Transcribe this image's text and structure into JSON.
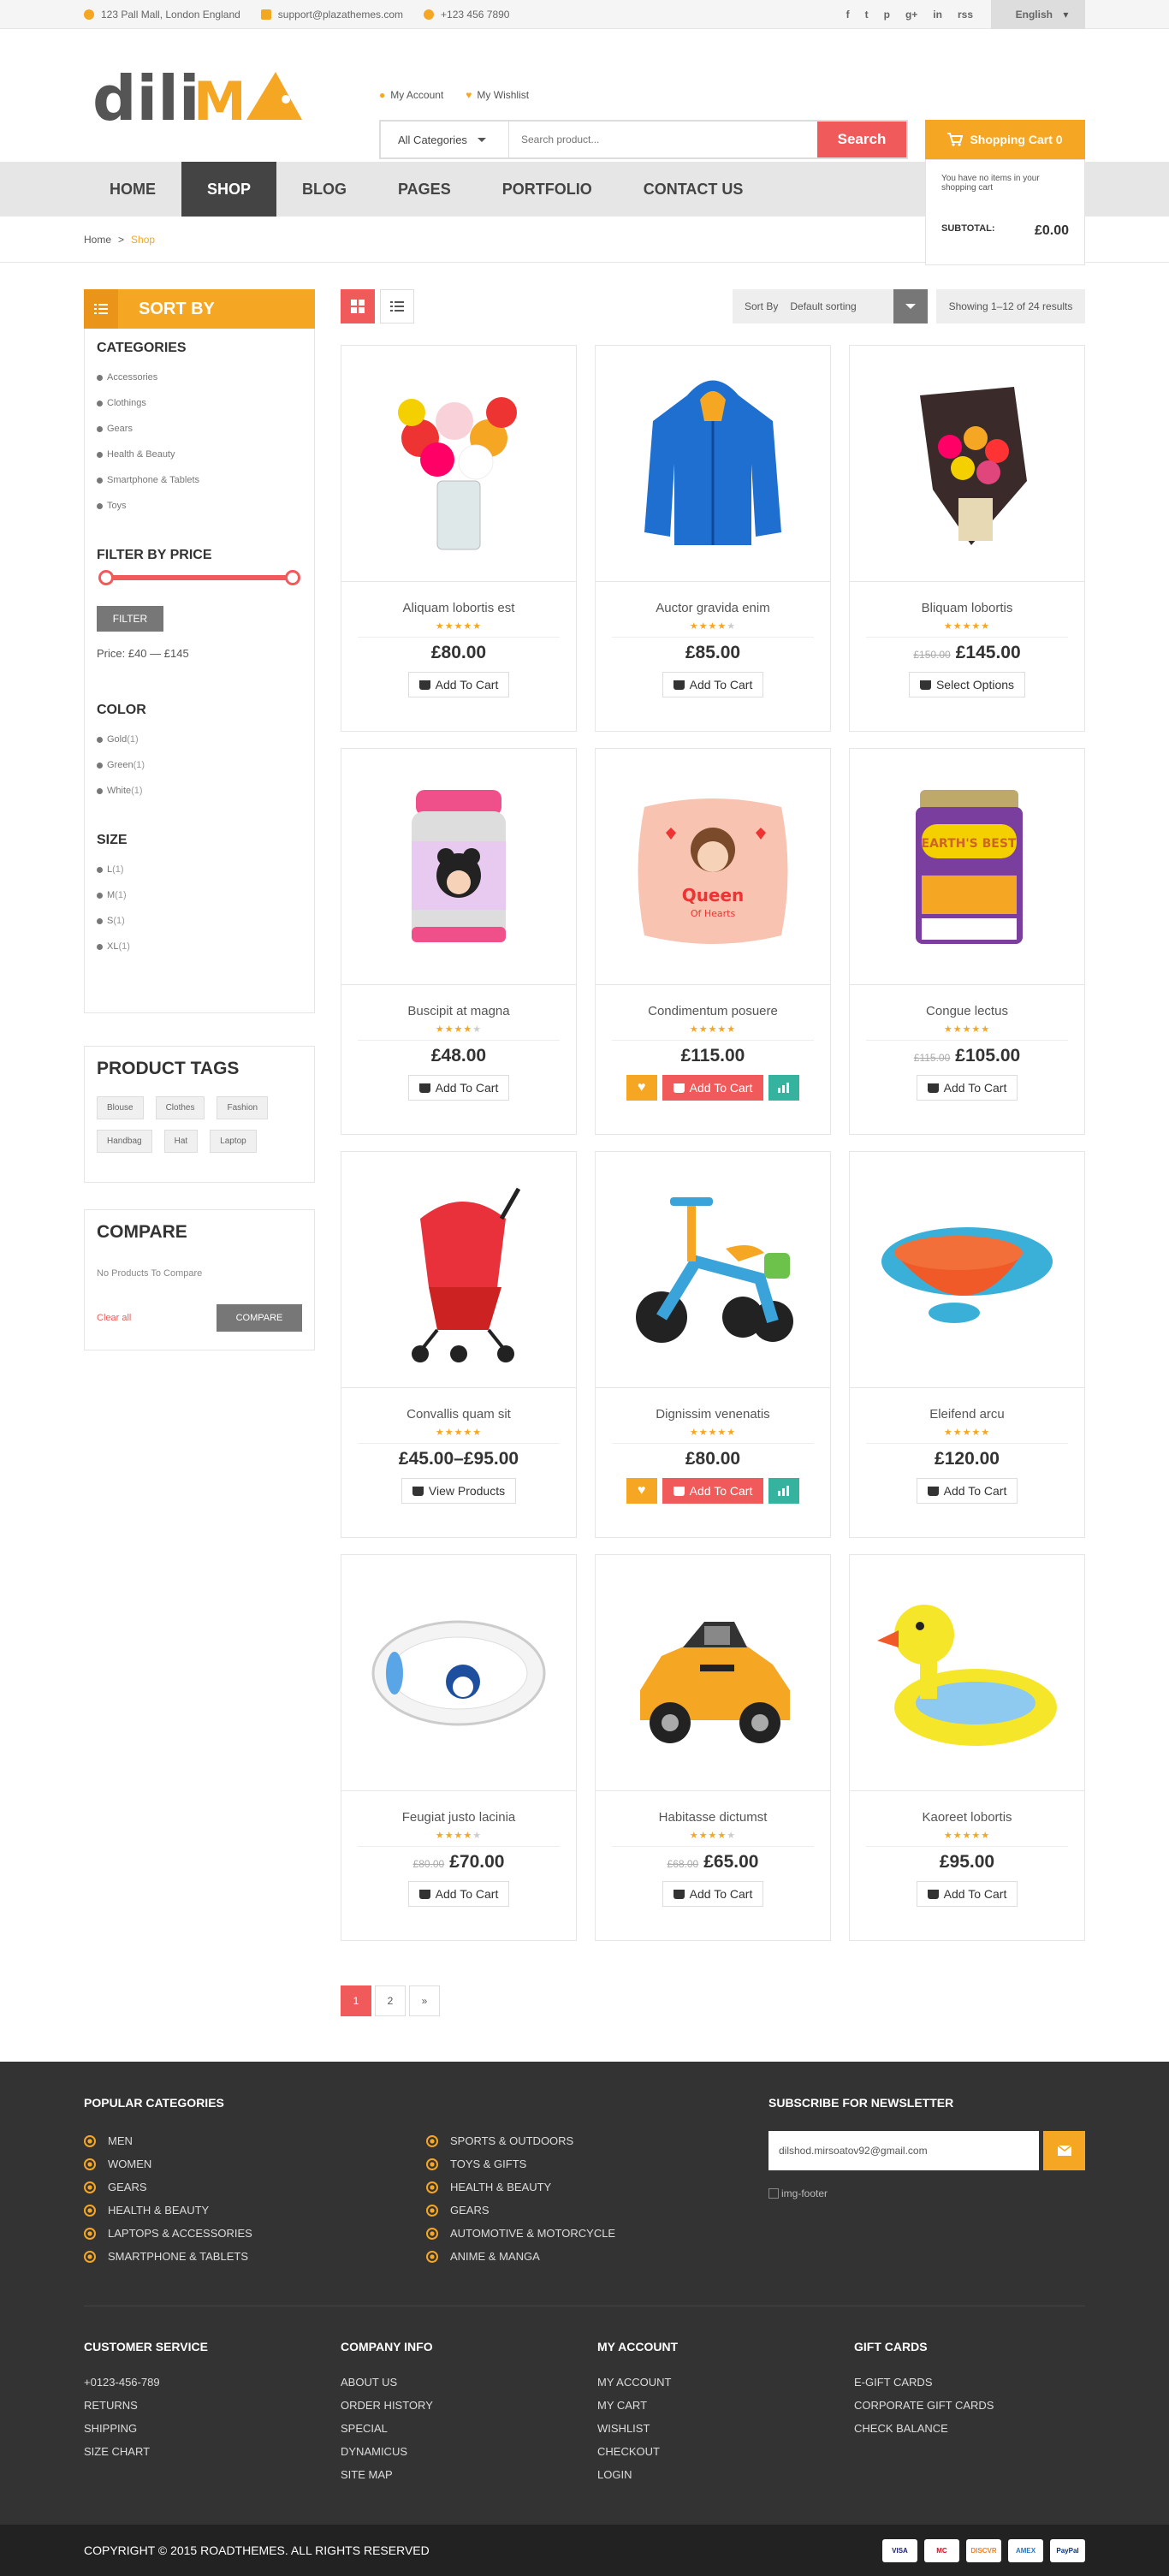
{
  "topbar": {
    "address": "123 Pall Mall, London England",
    "email": "support@plazathemes.com",
    "phone": "+123 456 7890",
    "social": [
      "f",
      "t",
      "p",
      "g+",
      "in",
      "rss"
    ],
    "language": "English"
  },
  "header": {
    "my_account": "My Account",
    "my_wishlist": "My Wishlist",
    "category": "All Categories",
    "search_placeholder": "Search product...",
    "search_button": "Search",
    "cart_label": "Shopping Cart 0",
    "cart_empty": "You have no items in your shopping cart",
    "subtotal_label": "SUBTOTAL:",
    "subtotal_value": "£0.00"
  },
  "nav": [
    "HOME",
    "SHOP",
    "BLOG",
    "PAGES",
    "PORTFOLIO",
    "CONTACT US"
  ],
  "breadcrumb": {
    "home": "Home",
    "sep": ">",
    "current": "Shop"
  },
  "sidebar": {
    "sort_by": "SORT BY",
    "categories_title": "CATEGORIES",
    "categories": [
      "Accessories",
      "Clothings",
      "Gears",
      "Health & Beauty",
      "Smartphone & Tablets",
      "Toys"
    ],
    "price_title": "FILTER BY PRICE",
    "filter_button": "FILTER",
    "price_text": "Price: £40 — £145",
    "color_title": "COLOR",
    "colors": [
      {
        "name": "Gold",
        "count": "(1)"
      },
      {
        "name": "Green",
        "count": "(1)"
      },
      {
        "name": "White",
        "count": "(1)"
      }
    ],
    "size_title": "SIZE",
    "sizes": [
      {
        "name": "L",
        "count": "(1)"
      },
      {
        "name": "M",
        "count": "(1)"
      },
      {
        "name": "S",
        "count": "(1)"
      },
      {
        "name": "XL",
        "count": "(1)"
      }
    ],
    "tags_title": "PRODUCT TAGS",
    "tags": [
      "Blouse",
      "Clothes",
      "Fashion",
      "Handbag",
      "Hat",
      "Laptop"
    ],
    "compare_title": "COMPARE",
    "compare_empty": "No Products To Compare",
    "clear_all": "Clear all",
    "compare_button": "COMPARE"
  },
  "toolbar": {
    "sort_label": "Sort By",
    "sort_value": "Default sorting",
    "showing": "Showing 1–12 of 24 results"
  },
  "products": [
    {
      "name": "Aliquam lobortis est",
      "rating": 5,
      "old": "",
      "price": "£80.00",
      "button": "Add To Cart",
      "hover": false,
      "img": "roses"
    },
    {
      "name": "Auctor gravida enim",
      "rating": 4,
      "old": "",
      "price": "£85.00",
      "button": "Add To Cart",
      "hover": false,
      "img": "jacket"
    },
    {
      "name": "Bliquam lobortis",
      "rating": 5,
      "old": "£150.00",
      "price": "£145.00",
      "button": "Select Options",
      "hover": false,
      "img": "tulips"
    },
    {
      "name": "Buscipit at magna",
      "rating": 4,
      "old": "",
      "price": "£48.00",
      "button": "Add To Cart",
      "hover": false,
      "img": "thermos"
    },
    {
      "name": "Condimentum posuere",
      "rating": 5,
      "old": "",
      "price": "£115.00",
      "button": "Add To Cart",
      "hover": true,
      "img": "pillow"
    },
    {
      "name": "Congue lectus",
      "rating": 5,
      "old": "£115.00",
      "price": "£105.00",
      "button": "Add To Cart",
      "hover": false,
      "img": "formula"
    },
    {
      "name": "Convallis quam sit",
      "rating": 5,
      "old": "",
      "price": "£45.00–£95.00",
      "button": "View Products",
      "hover": false,
      "img": "stroller"
    },
    {
      "name": "Dignissim venenatis",
      "rating": 5,
      "old": "",
      "price": "£80.00",
      "button": "Add To Cart",
      "hover": true,
      "img": "trike"
    },
    {
      "name": "Eleifend arcu",
      "rating": 5,
      "old": "",
      "price": "£120.00",
      "button": "Add To Cart",
      "hover": false,
      "img": "bowl"
    },
    {
      "name": "Feugiat justo lacinia",
      "rating": 4,
      "old": "£80.00",
      "price": "£70.00",
      "button": "Add To Cart",
      "hover": false,
      "img": "tub"
    },
    {
      "name": "Habitasse dictumst",
      "rating": 4,
      "old": "£68.00",
      "price": "£65.00",
      "button": "Add To Cart",
      "hover": false,
      "img": "car"
    },
    {
      "name": "Kaoreet lobortis",
      "rating": 5,
      "old": "",
      "price": "£95.00",
      "button": "Add To Cart",
      "hover": false,
      "img": "duck"
    }
  ],
  "pagination": [
    "1",
    "2",
    "»"
  ],
  "footer": {
    "popular_title": "POPULAR CATEGORIES",
    "popular_col1": [
      "MEN",
      "WOMEN",
      "GEARS",
      "HEALTH & BEAUTY",
      "LAPTOPS & ACCESSORIES",
      "SMARTPHONE & TABLETS"
    ],
    "popular_col2": [
      "SPORTS & OUTDOORS",
      "TOYS & GIFTS",
      "HEALTH & BEAUTY",
      "GEARS",
      "AUTOMOTIVE & MOTORCYCLE",
      "ANIME & MANGA"
    ],
    "newsletter_title": "SUBSCRIBE FOR NEWSLETTER",
    "newsletter_value": "dilshod.mirsoatov92@gmail.com",
    "img_footer": "img-footer",
    "customer_title": "CUSTOMER SERVICE",
    "customer": [
      "+0123-456-789",
      "RETURNS",
      "SHIPPING",
      "SIZE CHART"
    ],
    "company_title": "COMPANY INFO",
    "company": [
      "ABOUT US",
      "ORDER HISTORY",
      "SPECIAL",
      "DYNAMICUS",
      "SITE MAP"
    ],
    "account_title": "MY ACCOUNT",
    "account": [
      "MY ACCOUNT",
      "MY CART",
      "WISHLIST",
      "CHECKOUT",
      "LOGIN"
    ],
    "gift_title": "GIFT CARDS",
    "gift": [
      "E-GIFT CARDS",
      "CORPORATE GIFT CARDS",
      "CHECK BALANCE"
    ],
    "copyright": "COPYRIGHT © 2015 ROADTHEMES. ALL RIGHTS RESERVED",
    "payments": [
      "VISA",
      "MC",
      "DISCVR",
      "AMEX",
      "PayPal"
    ]
  },
  "colors": {
    "accent": "#f5a623",
    "red": "#f15a5a",
    "teal": "#36b39f",
    "dark": "#333333"
  }
}
